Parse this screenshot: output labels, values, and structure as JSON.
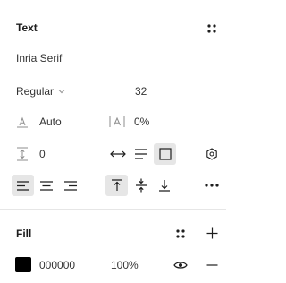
{
  "text_section": {
    "title": "Text",
    "font_family": "Inria Serif",
    "font_weight": "Regular",
    "font_size": "32",
    "line_height": "Auto",
    "letter_spacing": "0%",
    "paragraph_spacing": "0"
  },
  "fill_section": {
    "title": "Fill",
    "hex": "000000",
    "opacity": "100%",
    "swatch_color": "#000000"
  }
}
